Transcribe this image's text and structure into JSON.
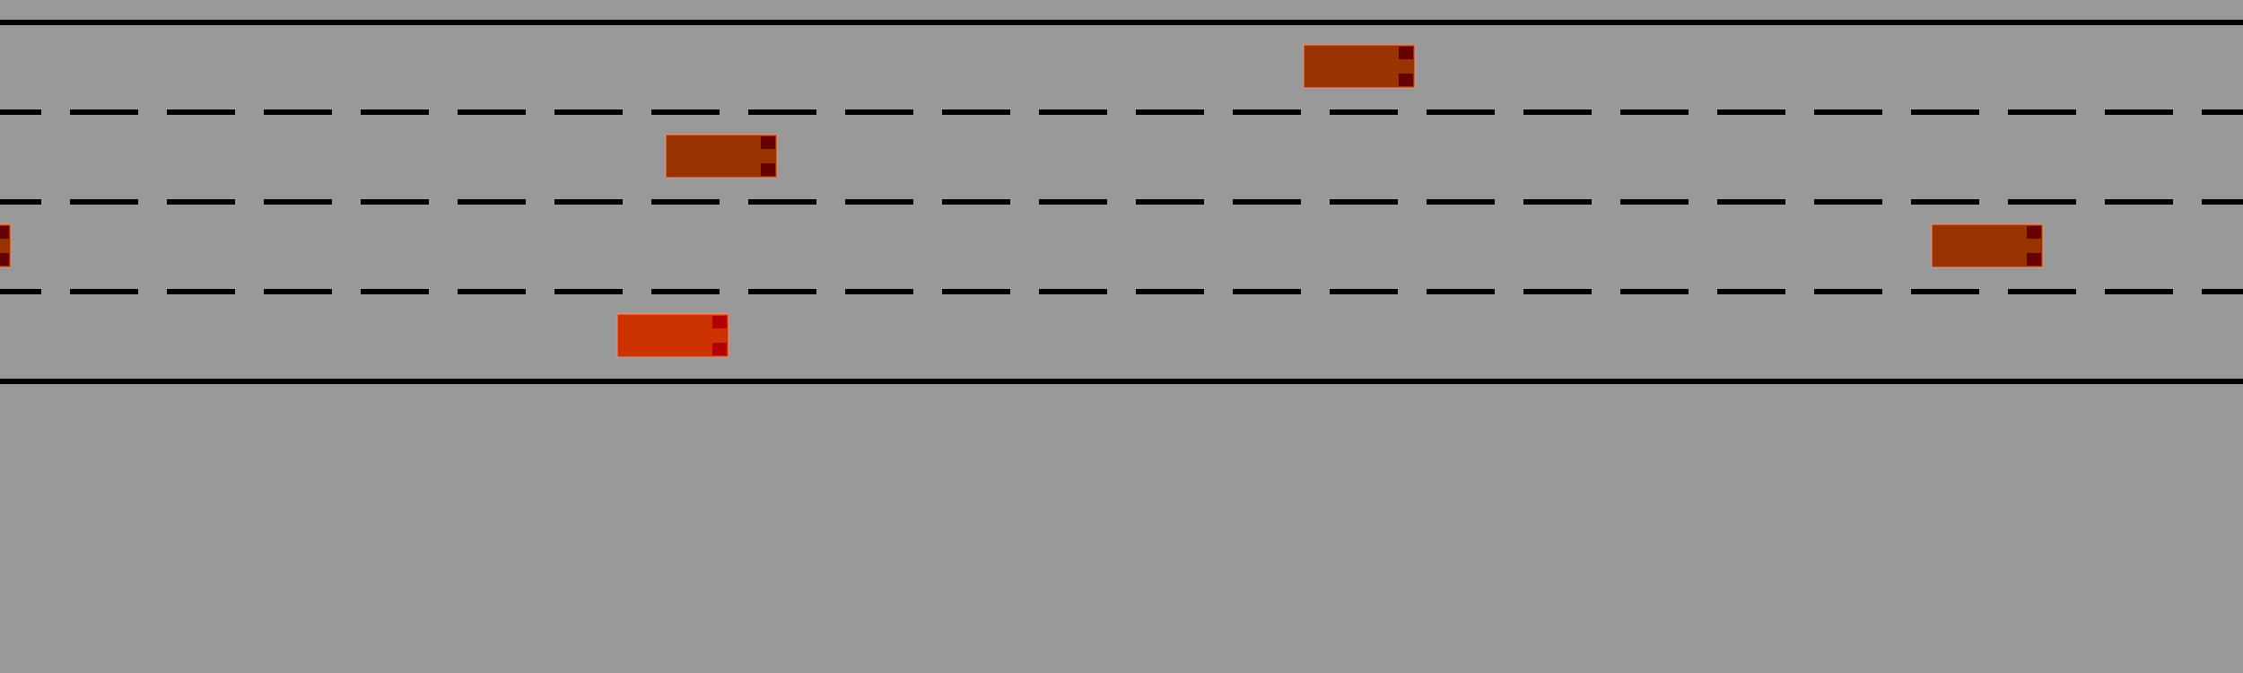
{
  "road": {
    "lane_count": 4,
    "colors": {
      "pavement": "#999999",
      "line": "#000000",
      "ego_car_body": "#cc3300",
      "ego_car_light": "#b30000",
      "other_car_body": "#993300",
      "other_car_light": "#660000",
      "car_outline": "#ff8c6b"
    }
  },
  "vehicles": [
    {
      "role": "other",
      "lane": 0
    },
    {
      "role": "other",
      "lane": 1
    },
    {
      "role": "other",
      "lane": 2
    },
    {
      "role": "other",
      "lane": 2
    },
    {
      "role": "ego",
      "lane": 3
    }
  ]
}
